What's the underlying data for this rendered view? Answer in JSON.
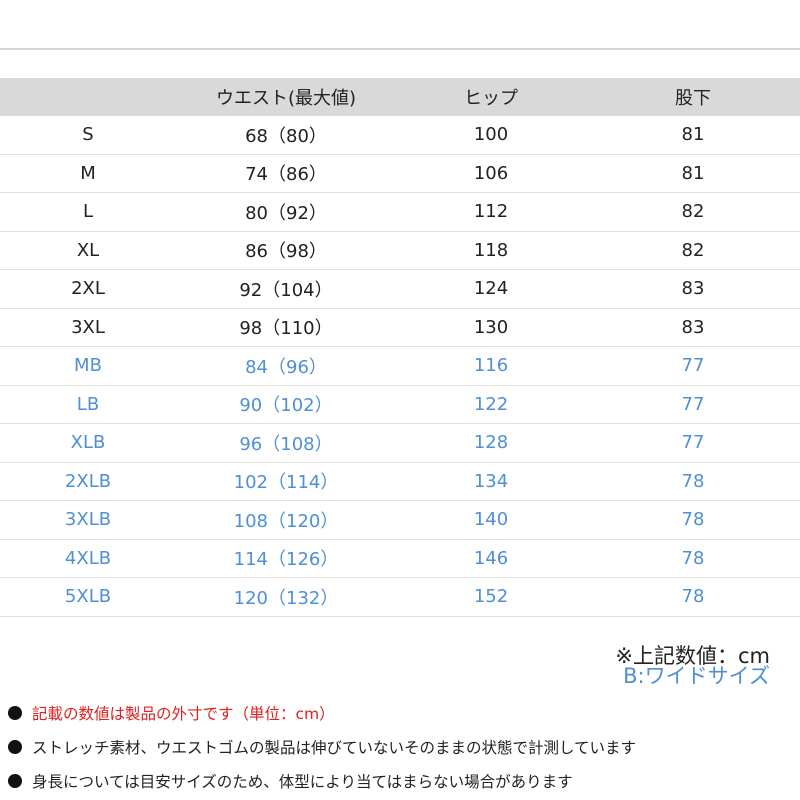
{
  "table": {
    "headers": [
      "",
      "ウエスト(最大値)",
      "ヒップ",
      "股下"
    ],
    "rows": [
      {
        "size": "S",
        "waist": "68（80）",
        "hip": "100",
        "inseam": "81",
        "wide": false
      },
      {
        "size": "M",
        "waist": "74（86）",
        "hip": "106",
        "inseam": "81",
        "wide": false
      },
      {
        "size": "L",
        "waist": "80（92）",
        "hip": "112",
        "inseam": "82",
        "wide": false
      },
      {
        "size": "XL",
        "waist": "86（98）",
        "hip": "118",
        "inseam": "82",
        "wide": false
      },
      {
        "size": "2XL",
        "waist": "92（104）",
        "hip": "124",
        "inseam": "83",
        "wide": false
      },
      {
        "size": "3XL",
        "waist": "98（110）",
        "hip": "130",
        "inseam": "83",
        "wide": false
      },
      {
        "size": "MB",
        "waist": "84（96）",
        "hip": "116",
        "inseam": "77",
        "wide": true
      },
      {
        "size": "LB",
        "waist": "90（102）",
        "hip": "122",
        "inseam": "77",
        "wide": true
      },
      {
        "size": "XLB",
        "waist": "96（108）",
        "hip": "128",
        "inseam": "77",
        "wide": true
      },
      {
        "size": "2XLB",
        "waist": "102（114）",
        "hip": "134",
        "inseam": "78",
        "wide": true
      },
      {
        "size": "3XLB",
        "waist": "108（120）",
        "hip": "140",
        "inseam": "78",
        "wide": true
      },
      {
        "size": "4XLB",
        "waist": "114（126）",
        "hip": "146",
        "inseam": "78",
        "wide": true
      },
      {
        "size": "5XLB",
        "waist": "120（132）",
        "hip": "152",
        "inseam": "78",
        "wide": true
      }
    ]
  },
  "notes": {
    "unit": "※上記数値：cm",
    "wide": "B:ワイドサイズ"
  },
  "bullets": [
    {
      "text": "記載の数値は製品の外寸です（単位：cm）",
      "highlight": true
    },
    {
      "text": "ストレッチ素材、ウエストゴムの製品は伸びていないそのままの状態で計測しています",
      "highlight": false
    },
    {
      "text": "身長については目安サイズのため、体型により当てはまらない場合があります",
      "highlight": false
    }
  ],
  "colors": {
    "header_bg": "#d9d9d9",
    "wide_size_text": "#4f8fd4",
    "highlight_text": "#e02020",
    "bullet_dot": "#111111"
  }
}
